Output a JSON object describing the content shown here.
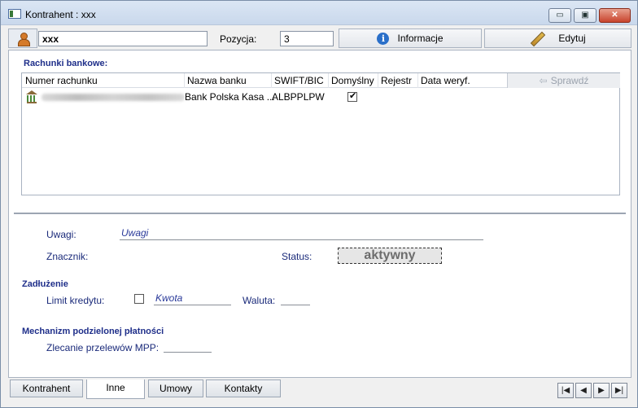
{
  "window": {
    "title": "Kontrahent : xxx",
    "controls": {
      "minimize": "▭",
      "maximize": "▣",
      "close": "✕"
    }
  },
  "header": {
    "name_value": "xxx",
    "pozycja_label": "Pozycja:",
    "pozycja_value": "3",
    "info_button": "Informacje",
    "edit_button": "Edytuj"
  },
  "bank_accounts": {
    "section_title": "Rachunki bankowe:",
    "columns": [
      "Numer rachunku",
      "Nazwa banku",
      "SWIFT/BIC",
      "Domyślny",
      "Rejestr",
      "Data weryf."
    ],
    "check_button": "Sprawdź",
    "rows": [
      {
        "account_number": "",
        "bank_name": "Bank Polska Kasa ...",
        "swift": "ALBPPLPW",
        "default": true,
        "registry": "",
        "verify_date": ""
      }
    ]
  },
  "details": {
    "uwagi_label": "Uwagi:",
    "uwagi_placeholder": "Uwagi",
    "znacznik_label": "Znacznik:",
    "status_label": "Status:",
    "status_value": "aktywny"
  },
  "debt": {
    "section_title": "Zadłużenie",
    "limit_label": "Limit kredytu:",
    "kwota_placeholder": "Kwota",
    "waluta_label": "Waluta:"
  },
  "split_payment": {
    "section_title": "Mechanizm podzielonej płatności",
    "mpp_label": "Zlecanie przelewów MPP:"
  },
  "tabs": [
    {
      "label": "Kontrahent",
      "active": false
    },
    {
      "label": "Inne",
      "active": true
    },
    {
      "label": "Umowy",
      "active": false
    },
    {
      "label": "Kontakty",
      "active": false
    }
  ],
  "nav": {
    "first": "|◀",
    "prev": "◀",
    "next": "▶",
    "last": "▶|"
  },
  "colors": {
    "section_title": "#1f2f8a",
    "label": "#1a2a7a",
    "placeholder": "#2a3a9a"
  }
}
